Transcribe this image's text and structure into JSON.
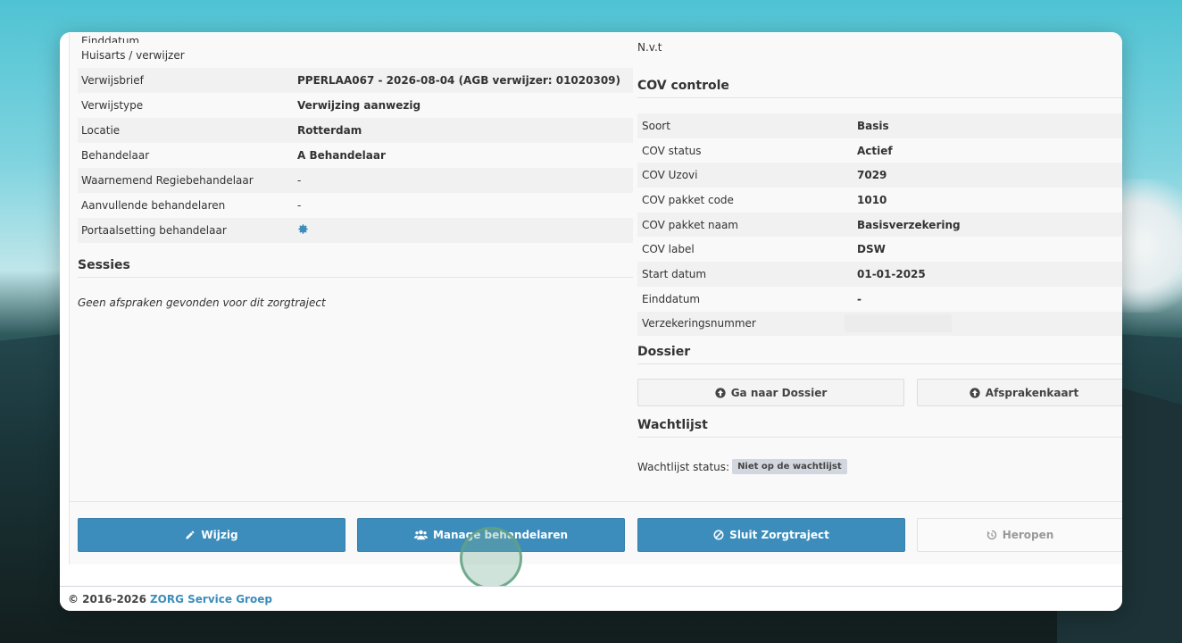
{
  "left_details": [
    {
      "key": "Einddatum",
      "value": "",
      "striped": false,
      "cut": true
    },
    {
      "key": "Huisarts / verwijzer",
      "value": "",
      "striped": false,
      "blank": true
    },
    {
      "key": "Verwijsbrief",
      "value": "PPERLAA067 - 2026-08-04 (AGB verwijzer: 01020309)",
      "striped": true
    },
    {
      "key": "Verwijstype",
      "value": "Verwijzing aanwezig",
      "striped": false
    },
    {
      "key": "Locatie",
      "value": "Rotterdam",
      "striped": true
    },
    {
      "key": "Behandelaar",
      "value": "A Behandelaar",
      "striped": false
    },
    {
      "key": "Waarnemend Regiebehandelaar",
      "value": "-",
      "striped": true
    },
    {
      "key": "Aanvullende behandelaren",
      "value": "-",
      "striped": false
    },
    {
      "key": "Portaalsetting behandelaar",
      "value": "",
      "striped": true,
      "gear": true
    }
  ],
  "sessies": {
    "title": "Sessies",
    "empty_text": "Geen afspraken gevonden voor dit zorgtraject"
  },
  "right_top_value": "N.v.t",
  "cov": {
    "title": "COV controle",
    "rows": [
      {
        "key": "Soort",
        "value": "Basis"
      },
      {
        "key": "COV status",
        "value": "Actief"
      },
      {
        "key": "COV Uzovi",
        "value": "7029"
      },
      {
        "key": "COV pakket code",
        "value": "1010"
      },
      {
        "key": "COV pakket naam",
        "value": "Basisverzekering"
      },
      {
        "key": "COV label",
        "value": "DSW"
      },
      {
        "key": "Start datum",
        "value": "01-01-2025"
      },
      {
        "key": "Einddatum",
        "value": "-"
      },
      {
        "key": "Verzekeringsnummer",
        "value": ""
      }
    ]
  },
  "dossier": {
    "title": "Dossier",
    "go_label": "Ga naar Dossier",
    "card_label": "Afsprakenkaart"
  },
  "wachtlijst": {
    "title": "Wachtlijst",
    "status_label": "Wachtlijst status:",
    "status_badge": "Niet op de wachtlijst"
  },
  "actions": {
    "edit": "Wijzig",
    "manage": "Manage behandelaren",
    "close": "Sluit Zorgtraject",
    "reopen": "Heropen"
  },
  "footer": {
    "copyright": "© 2016-2026",
    "company": "ZORG Service Groep"
  },
  "colors": {
    "primary": "#3c8dbc",
    "badge": "#d2d6de"
  }
}
